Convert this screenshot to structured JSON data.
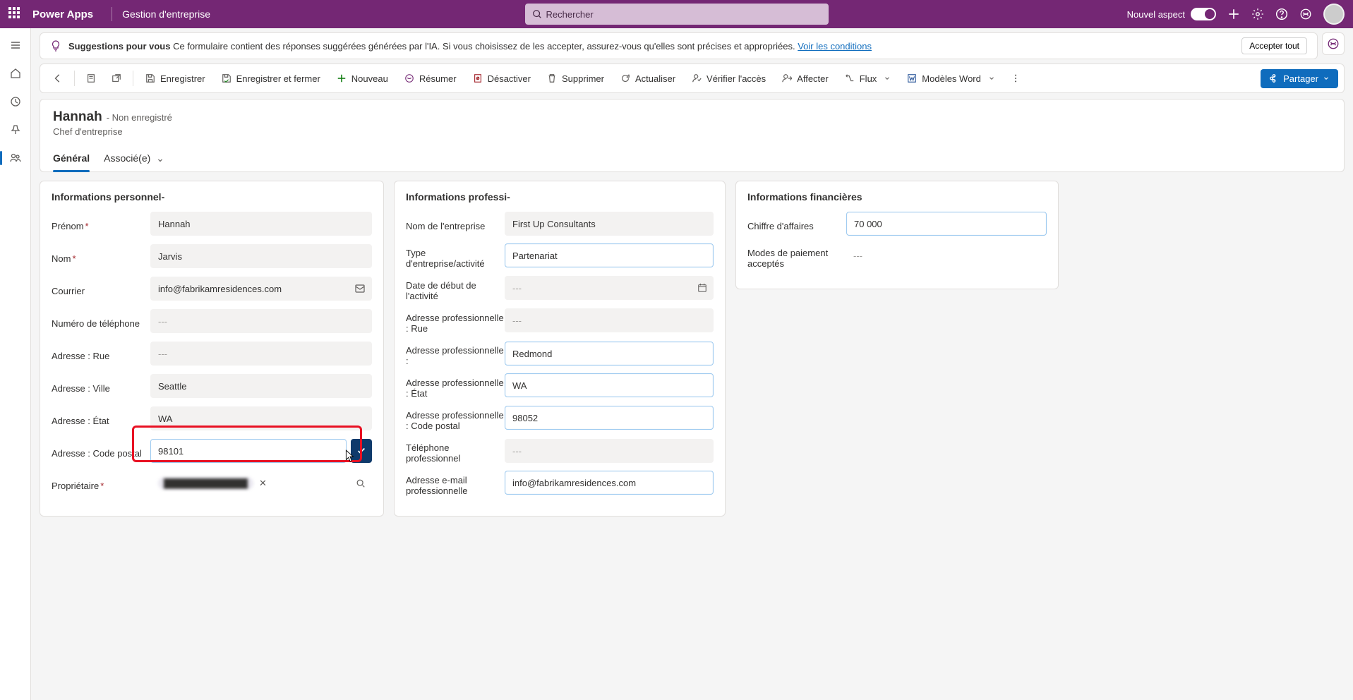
{
  "header": {
    "app_name": "Power Apps",
    "env_name": "Gestion d'entreprise",
    "search_placeholder": "Rechercher",
    "new_look_label": "Nouvel aspect"
  },
  "suggestion_bar": {
    "prefix_bold": "Suggestions pour vous",
    "text": " Ce formulaire contient des réponses suggérées générées par l'IA. Si vous choisissez de les accepter, assurez-vous qu'elles sont précises et appropriées. ",
    "link": "Voir les conditions",
    "accept_all": "Accepter tout"
  },
  "commands": {
    "save": "Enregistrer",
    "save_close": "Enregistrer et fermer",
    "new": "Nouveau",
    "summarize": "Résumer",
    "deactivate": "Désactiver",
    "delete": "Supprimer",
    "refresh": "Actualiser",
    "check_access": "Vérifier l'accès",
    "assign": "Affecter",
    "flow": "Flux",
    "word_templates": "Modèles Word",
    "share": "Partager"
  },
  "record": {
    "name": "Hannah",
    "unsaved": "- Non enregistré",
    "subtitle": "Chef d'entreprise",
    "tabs": {
      "general": "Général",
      "related": "Associé(e)"
    }
  },
  "sections": {
    "personal_title": "Informations personnel-",
    "professional_title": "Informations professi-",
    "financial_title": "Informations financières"
  },
  "personal": {
    "firstname_label": "Prénom",
    "firstname_value": "Hannah",
    "lastname_label": "Nom",
    "lastname_value": "Jarvis",
    "email_label": "Courrier",
    "email_value": "info@fabrikamresidences.com",
    "phone_label": "Numéro de téléphone",
    "phone_value": "---",
    "street_label": "Adresse : Rue",
    "street_value": "---",
    "city_label": "Adresse : Ville",
    "city_value": "Seattle",
    "state_label": "Adresse : État",
    "state_value": "WA",
    "postal_label": "Adresse : Code postal",
    "postal_value": "98101",
    "owner_label": "Propriétaire"
  },
  "professional": {
    "company_label": "Nom de l'entreprise",
    "company_value": "First Up Consultants",
    "btype_label": "Type d'entreprise/activité",
    "btype_value": "Partenariat",
    "start_label": "Date de début de l'activité",
    "start_value": "---",
    "bstreet_label": "Adresse professionnelle : Rue",
    "bstreet_value": "---",
    "bcity_label": "Adresse professionnelle :",
    "bcity_value": "Redmond",
    "bstate_label": "Adresse professionnelle : État",
    "bstate_value": "WA",
    "bpostal_label": "Adresse professionnelle : Code postal",
    "bpostal_value": "98052",
    "bphone_label": "Téléphone professionnel",
    "bphone_value": "---",
    "bemail_label": "Adresse e-mail professionnelle",
    "bemail_value": "info@fabrikamresidences.com"
  },
  "financial": {
    "revenue_label": "Chiffre d'affaires",
    "revenue_value": "70 000",
    "payment_label": "Modes de paiement acceptés",
    "payment_value": "---"
  }
}
